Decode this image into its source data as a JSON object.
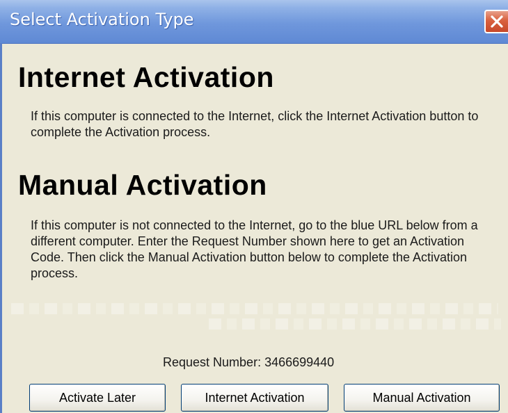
{
  "window": {
    "title": "Select Activation Type",
    "close_icon": "close-icon"
  },
  "internet": {
    "heading": "Internet Activation",
    "description": "If this computer is connected to the Internet, click the Internet Activation button to complete the Activation process."
  },
  "manual": {
    "heading": "Manual Activation",
    "description": "If this computer is not connected to the Internet, go to the blue URL below from a different computer.  Enter the Request Number shown here to get an Activation Code.  Then click the Manual Activation button below to complete the Activation process."
  },
  "request": {
    "text": "Request Number: 3466699440"
  },
  "buttons": {
    "activate_later": "Activate Later",
    "internet_activation": "Internet Activation",
    "manual_activation": "Manual Activation"
  },
  "colors": {
    "titlebar": "#6f97dc",
    "close_button": "#d9613f",
    "dialog_background": "#ece9d8"
  }
}
